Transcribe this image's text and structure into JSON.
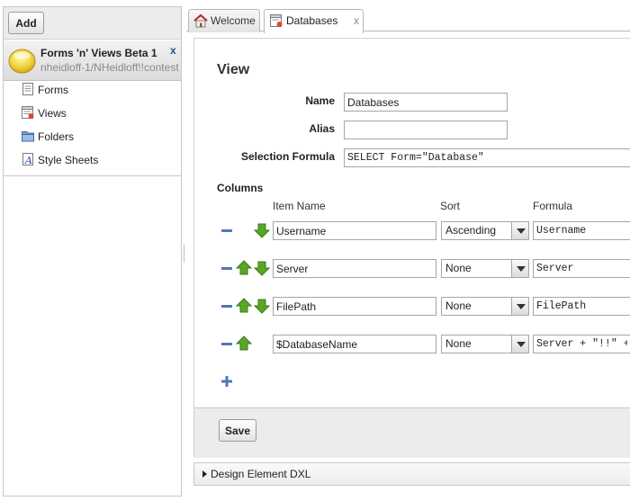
{
  "left": {
    "add_label": "Add",
    "app": {
      "title": "Forms 'n' Views Beta 1",
      "path": "nheidloff-1/NHeidloff!!contest",
      "close_label": "x"
    },
    "nav": [
      {
        "label": "Forms",
        "icon": "form-icon"
      },
      {
        "label": "Views",
        "icon": "view-icon"
      },
      {
        "label": "Folders",
        "icon": "folder-icon"
      },
      {
        "label": "Style Sheets",
        "icon": "stylesheet-icon"
      }
    ]
  },
  "tabs": [
    {
      "label": "Welcome",
      "icon": "home-icon"
    },
    {
      "label": "Databases",
      "icon": "database-icon",
      "close": "x"
    }
  ],
  "view": {
    "title": "View",
    "name_label": "Name",
    "name_value": "Databases",
    "alias_label": "Alias",
    "alias_value": "",
    "formula_label": "Selection Formula",
    "formula_value": "SELECT Form=\"Database\"",
    "columns_label": "Columns",
    "col_headers": {
      "item": "Item Name",
      "sort": "Sort",
      "formula": "Formula"
    },
    "columns": [
      {
        "item": "Username",
        "sort": "Ascending",
        "formula": "Username"
      },
      {
        "item": "Server",
        "sort": "None",
        "formula": "Server"
      },
      {
        "item": "FilePath",
        "sort": "None",
        "formula": "FilePath"
      },
      {
        "item": "$DatabaseName",
        "sort": "None",
        "formula": "Server + \"!!\" + "
      }
    ]
  },
  "footer": {
    "save_label": "Save"
  },
  "dxl_label": "Design Element DXL",
  "colors": {
    "arrow_green": "#5aa628",
    "minus_blue": "#4f79b5"
  }
}
